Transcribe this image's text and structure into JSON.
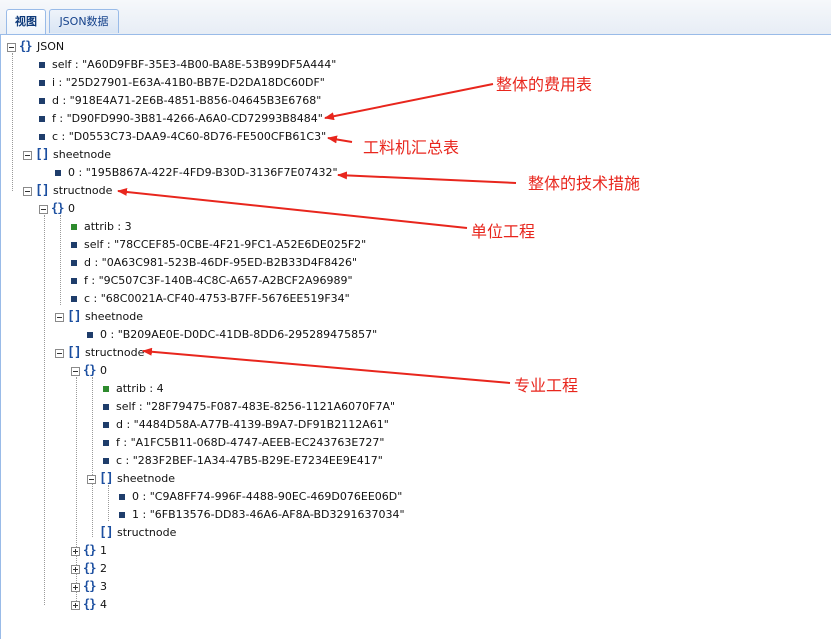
{
  "tabs": [
    {
      "label": "视图",
      "active": true
    },
    {
      "label": "JSON数据",
      "active": false
    }
  ],
  "tree": {
    "root": "JSON",
    "self": "self : \"A60D9FBF-35E3-4B00-BA8E-53B99DF5A444\"",
    "i": "i : \"25D27901-E63A-41B0-BB7E-D2DA18DC60DF\"",
    "d": "d : \"918E4A71-2E6B-4851-B856-04645B3E6768\"",
    "f": "f : \"D90FD990-3B81-4266-A6A0-CD72993B8484\"",
    "c": "c : \"D0553C73-DAA9-4C60-8D76-FE500CFB61C3\"",
    "sheetnode": "sheetnode",
    "sheet0": "0 : \"195B867A-422F-4FD9-B30D-3136F7E07432\"",
    "structnode": "structnode",
    "s0": {
      "label": "0",
      "attrib": "attrib : 3",
      "self": "self : \"78CCEF85-0CBE-4F21-9FC1-A52E6DE025F2\"",
      "d": "d : \"0A63C981-523B-46DF-95ED-B2B33D4F8426\"",
      "f": "f : \"9C507C3F-140B-4C8C-A657-A2BCF2A96989\"",
      "c": "c : \"68C0021A-CF40-4753-B7FF-5676EE519F34\"",
      "sheetnode": "sheetnode",
      "sheet0": "0 : \"B209AE0E-D0DC-41DB-8DD6-295289475857\"",
      "structnode": "structnode",
      "s0": {
        "label": "0",
        "attrib": "attrib : 4",
        "self": "self : \"28F79475-F087-483E-8256-1121A6070F7A\"",
        "d": "d : \"4484D58A-A77B-4139-B9A7-DF91B2112A61\"",
        "f": "f : \"A1FC5B11-068D-4747-AEEB-EC243763E727\"",
        "c": "c : \"283F2BEF-1A34-47B5-B29E-E7234EE9E417\"",
        "sheetnode": "sheetnode",
        "sheet0": "0 : \"C9A8FF74-996F-4488-90EC-469D076EE06D\"",
        "sheet1": "1 : \"6FB13576-DD83-46A6-AF8A-BD3291637034\"",
        "structnode": "structnode"
      },
      "collapsed": [
        "1",
        "2",
        "3",
        "4"
      ]
    }
  },
  "annotations": {
    "a1": "整体的费用表",
    "a2": "工料机汇总表",
    "a3": "整体的技术措施",
    "a4": "单位工程",
    "a5": "专业工程"
  },
  "colors": {
    "annotation": "#e8261d",
    "icon": "#1c4fa0",
    "tab_border": "#99bbe8"
  },
  "icons": {
    "object": "curly-braces-icon",
    "array": "square-brackets-icon",
    "leaf": "square-bullet-icon",
    "expand": "plus-box-icon",
    "collapse": "minus-box-icon"
  }
}
